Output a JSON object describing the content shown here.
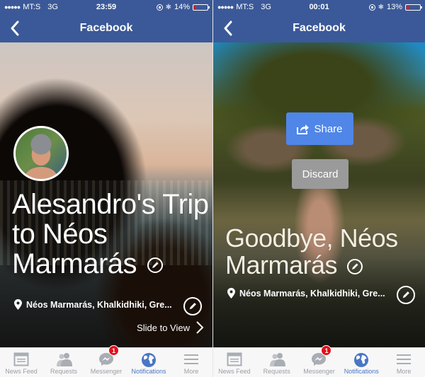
{
  "screens": [
    {
      "status": {
        "carrier": "MT:S",
        "network": "3G",
        "time": "23:59",
        "battery": "14%",
        "battery_level": 0.14
      },
      "nav": {
        "title": "Facebook",
        "back_icon": "chevron-left-icon"
      },
      "title": "Alesandro's Trip to Néos Marmarás",
      "location": "Néos Marmarás, Khalkidhiki, Gre...",
      "slide_label": "Slide to View"
    },
    {
      "status": {
        "carrier": "MT:S",
        "network": "3G",
        "time": "00:01",
        "battery": "13%",
        "battery_level": 0.13
      },
      "nav": {
        "title": "Facebook",
        "back_icon": "chevron-left-icon"
      },
      "title": "Goodbye, Néos Marmarás",
      "location": "Néos Marmarás, Khalkidhiki, Gre...",
      "share_label": "Share",
      "discard_label": "Discard"
    }
  ],
  "tabbar": {
    "items": [
      {
        "label": "News Feed",
        "icon": "news-feed-icon"
      },
      {
        "label": "Requests",
        "icon": "friend-requests-icon"
      },
      {
        "label": "Messenger",
        "icon": "messenger-icon",
        "badge": "1"
      },
      {
        "label": "Notifications",
        "icon": "globe-icon",
        "active": true
      },
      {
        "label": "More",
        "icon": "menu-icon"
      }
    ]
  },
  "colors": {
    "brand": "#3b5998",
    "share": "#4f86e8",
    "discard": "#9a9a9a",
    "active_tab": "#4a76c4",
    "badge": "#e0101a"
  }
}
